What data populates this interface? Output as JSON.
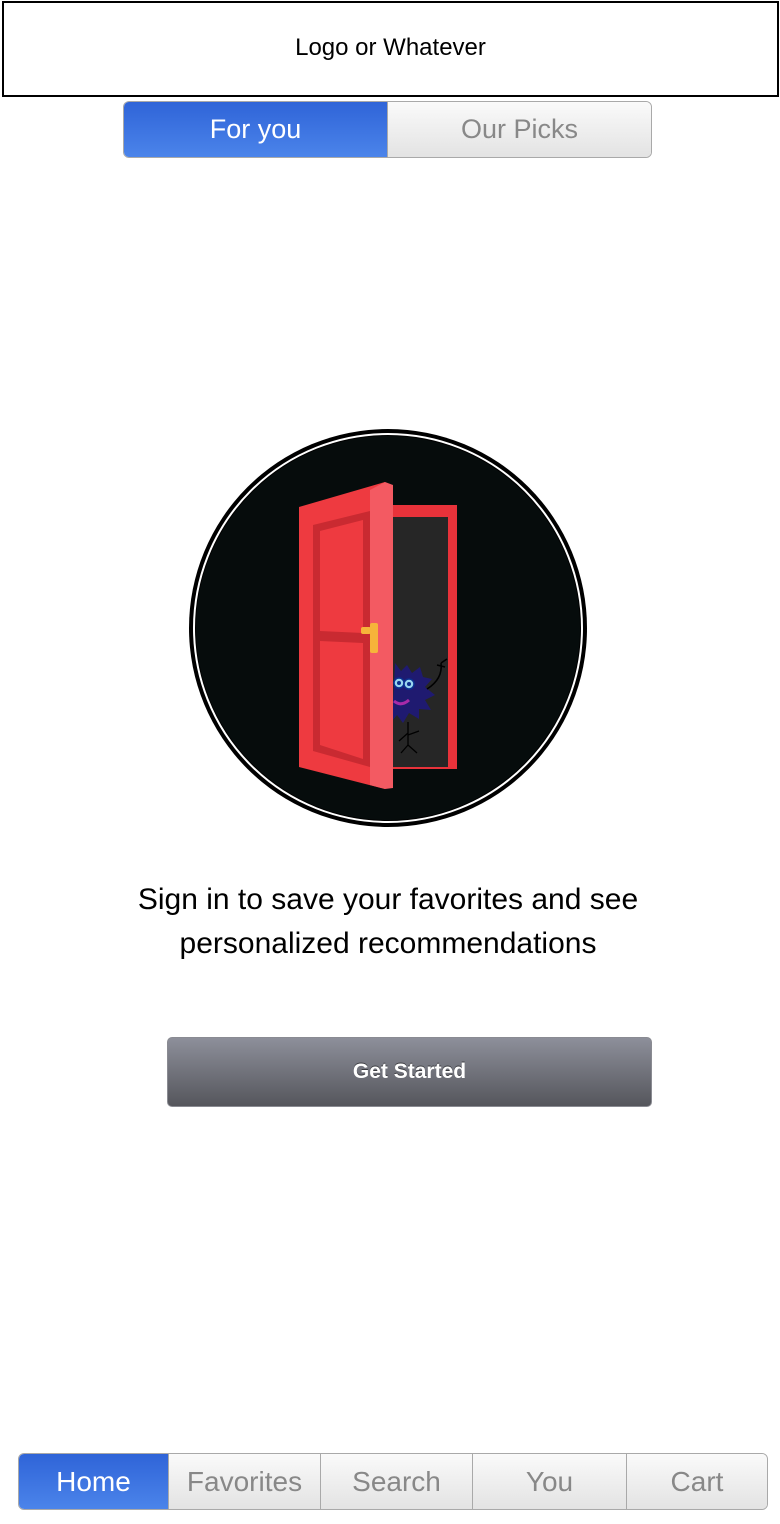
{
  "header": {
    "title": "Logo or Whatever"
  },
  "segments": {
    "items": [
      {
        "label": "For you",
        "active": true
      },
      {
        "label": "Our Picks",
        "active": false
      }
    ]
  },
  "illustration": {
    "icon": "open-door-with-monster-icon"
  },
  "message": {
    "line1": "Sign in to save your favorites and see",
    "line2": "personalized recommendations"
  },
  "cta": {
    "label": "Get Started"
  },
  "tabbar": {
    "items": [
      {
        "label": "Home",
        "active": true
      },
      {
        "label": "Favorites",
        "active": false
      },
      {
        "label": "Search",
        "active": false
      },
      {
        "label": "You",
        "active": false
      },
      {
        "label": "Cart",
        "active": false
      }
    ]
  },
  "colors": {
    "accent": "#2f64d8",
    "door": "#e8323a",
    "circle_bg": "#060c0c",
    "button": "#6e7078"
  }
}
